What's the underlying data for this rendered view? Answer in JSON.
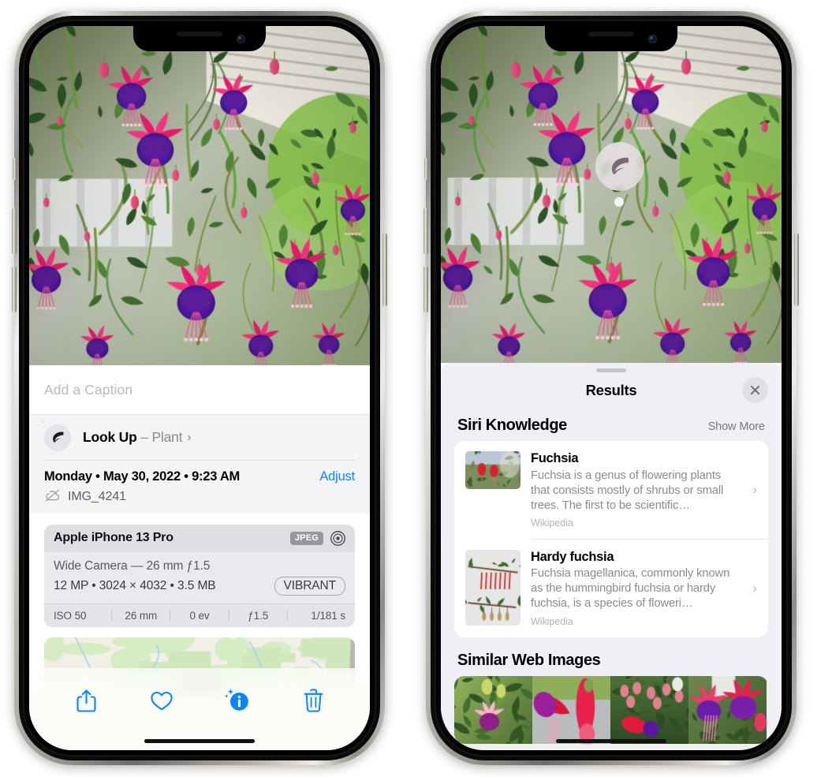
{
  "left_phone": {
    "photo_alt": "Fuchsia flowers hanging basket on porch",
    "caption_placeholder": "Add a Caption",
    "lookup": {
      "icon": "leaf-icon",
      "sparkle_icon": "sparkles-icon",
      "label": "Look Up",
      "dash": " – ",
      "subject": "Plant",
      "chevron": "›"
    },
    "date_line": "Monday • May 30, 2022 • 9:23 AM",
    "adjust_label": "Adjust",
    "cloud_icon": "cloud-slash-icon",
    "file_name": "IMG_4241",
    "exif": {
      "device": "Apple iPhone 13 Pro",
      "format_tag": "JPEG",
      "aperture_icon": "aperture-icon",
      "lens_line": "Wide Camera — 26 mm ƒ1.5",
      "size_line": "12 MP • 3024 × 4032 • 3.5 MB",
      "style_pill": "VIBRANT",
      "stats": [
        "ISO 50",
        "26 mm",
        "0 ev",
        "ƒ1.5",
        "1/181 s"
      ]
    },
    "map_alt": "Map showing photo location",
    "toolbar": [
      {
        "name": "share-button",
        "icon": "share-icon",
        "active": false
      },
      {
        "name": "favorite-button",
        "icon": "heart-icon",
        "active": false
      },
      {
        "name": "info-button",
        "icon": "info-sparkle-icon",
        "active": true
      },
      {
        "name": "delete-button",
        "icon": "trash-icon",
        "active": false
      }
    ]
  },
  "right_phone": {
    "photo_alt": "Fuchsia flowers hanging basket on porch",
    "marker": {
      "icon": "leaf-icon",
      "label": "visual-lookup-marker"
    },
    "grabber": "sheet-grabber",
    "results_title": "Results",
    "close_icon": "close-icon",
    "siri_section": {
      "title": "Siri Knowledge",
      "action": "Show More",
      "items": [
        {
          "title": "Fuchsia",
          "description": "Fuchsia is a genus of flowering plants that consists mostly of shrubs or small trees. The first to be scientific…",
          "source": "Wikipedia",
          "chevron": "›",
          "thumb": "fuchsia-red-flowers-thumbnail"
        },
        {
          "title": "Hardy fuchsia",
          "description": "Fuchsia magellanica, commonly known as the hummingbird fuchsia or hardy fuchsia, is a species of floweri…",
          "source": "Wikipedia",
          "chevron": "›",
          "thumb": "hardy-fuchsia-branch-thumbnail"
        }
      ]
    },
    "similar_section": {
      "title": "Similar Web Images",
      "images": [
        "fuchsia-pink-white-bloom",
        "fuchsia-red-closeup",
        "fuchsia-bush-buds",
        "fuchsia-purple-pink-cluster"
      ]
    }
  },
  "colors": {
    "accent_blue": "#0a84ff",
    "sheet_bg": "#f0eff5",
    "card_bg": "#ffffff",
    "secondary_text": "#8b8b91",
    "exif_bg": "#e9e9ee"
  }
}
